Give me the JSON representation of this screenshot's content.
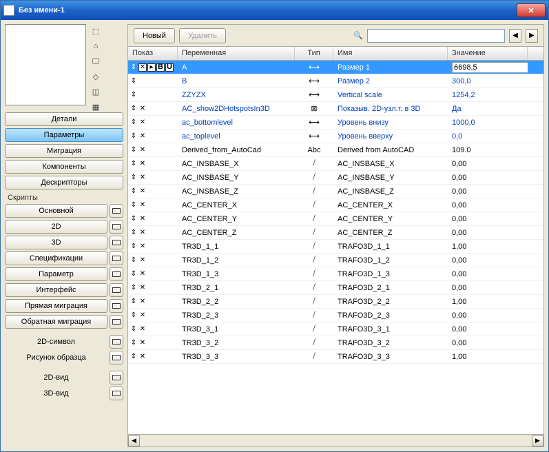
{
  "window": {
    "title": "Без имени-1"
  },
  "toolbar": {
    "new": "Новый",
    "delete": "Удалить"
  },
  "sidebar": {
    "details": "Детали",
    "parameters": "Параметры",
    "migration": "Миграция",
    "components": "Компоненты",
    "descriptors": "Дескрипторы",
    "scripts_label": "Скрипты",
    "main": "Основной",
    "s2d": "2D",
    "s3d": "3D",
    "specs": "Спецификации",
    "param": "Параметр",
    "interface": "Интерфейс",
    "fwd_migration": "Прямая миграция",
    "back_migration": "Обратная миграция",
    "symbol2d": "2D-символ",
    "sample_img": "Рисунок образца",
    "view2d": "2D-вид",
    "view3d": "3D-вид"
  },
  "columns": {
    "pokaz": "Показ",
    "var": "Переменная",
    "type": "Тип",
    "name": "Имя",
    "value": "Значение"
  },
  "rows": [
    {
      "link": true,
      "selected": true,
      "pokaz": "full",
      "var": "A",
      "type": "dim",
      "name": "Размер 1",
      "value": "6698,5"
    },
    {
      "link": true,
      "pokaz": "drag",
      "var": "B",
      "type": "dim2",
      "name": "Размер 2",
      "value": "300,0"
    },
    {
      "link": true,
      "pokaz": "drag",
      "var": "ZZYZX",
      "type": "dim3",
      "name": "Vertical scale",
      "value": "1254,2"
    },
    {
      "link": true,
      "pokaz": "x",
      "var": "AC_show2DHotspotsIn3D",
      "type": "bool",
      "name": "Показыв. 2D-узл.т. в 3D",
      "value": "Да"
    },
    {
      "link": true,
      "pokaz": "x",
      "var": "ac_bottomlevel",
      "type": "dim3",
      "name": "Уровень внизу",
      "value": "1000,0"
    },
    {
      "link": true,
      "pokaz": "x",
      "var": "ac_toplevel",
      "type": "dim3",
      "name": "Уровень вверху",
      "value": "0,0"
    },
    {
      "pokaz": "x",
      "var": "Derived_from_AutoCad",
      "type": "Abc",
      "name": "Derived from AutoCAD",
      "value": "109.0"
    },
    {
      "pokaz": "x",
      "var": "AC_INSBASE_X",
      "type": "real",
      "name": "AC_INSBASE_X",
      "value": "0,00"
    },
    {
      "pokaz": "x",
      "var": "AC_INSBASE_Y",
      "type": "real",
      "name": "AC_INSBASE_Y",
      "value": "0,00"
    },
    {
      "pokaz": "x",
      "var": "AC_INSBASE_Z",
      "type": "real",
      "name": "AC_INSBASE_Z",
      "value": "0,00"
    },
    {
      "pokaz": "x",
      "var": "AC_CENTER_X",
      "type": "real",
      "name": "AC_CENTER_X",
      "value": "0,00"
    },
    {
      "pokaz": "x",
      "var": "AC_CENTER_Y",
      "type": "real",
      "name": "AC_CENTER_Y",
      "value": "0,00"
    },
    {
      "pokaz": "x",
      "var": "AC_CENTER_Z",
      "type": "real",
      "name": "AC_CENTER_Z",
      "value": "0,00"
    },
    {
      "pokaz": "x",
      "var": "TR3D_1_1",
      "type": "real",
      "name": "TRAFO3D_1_1",
      "value": "1,00"
    },
    {
      "pokaz": "x",
      "var": "TR3D_1_2",
      "type": "real",
      "name": "TRAFO3D_1_2",
      "value": "0,00"
    },
    {
      "pokaz": "x",
      "var": "TR3D_1_3",
      "type": "real",
      "name": "TRAFO3D_1_3",
      "value": "0,00"
    },
    {
      "pokaz": "x",
      "var": "TR3D_2_1",
      "type": "real",
      "name": "TRAFO3D_2_1",
      "value": "0,00"
    },
    {
      "pokaz": "x",
      "var": "TR3D_2_2",
      "type": "real",
      "name": "TRAFO3D_2_2",
      "value": "1,00"
    },
    {
      "pokaz": "x",
      "var": "TR3D_2_3",
      "type": "real",
      "name": "TRAFO3D_2_3",
      "value": "0,00"
    },
    {
      "pokaz": "x",
      "var": "TR3D_3_1",
      "type": "real",
      "name": "TRAFO3D_3_1",
      "value": "0,00"
    },
    {
      "pokaz": "x",
      "var": "TR3D_3_2",
      "type": "real",
      "name": "TRAFO3D_3_2",
      "value": "0,00"
    },
    {
      "pokaz": "x",
      "var": "TR3D_3_3",
      "type": "real",
      "name": "TRAFO3D_3_3",
      "value": "1,00"
    }
  ]
}
